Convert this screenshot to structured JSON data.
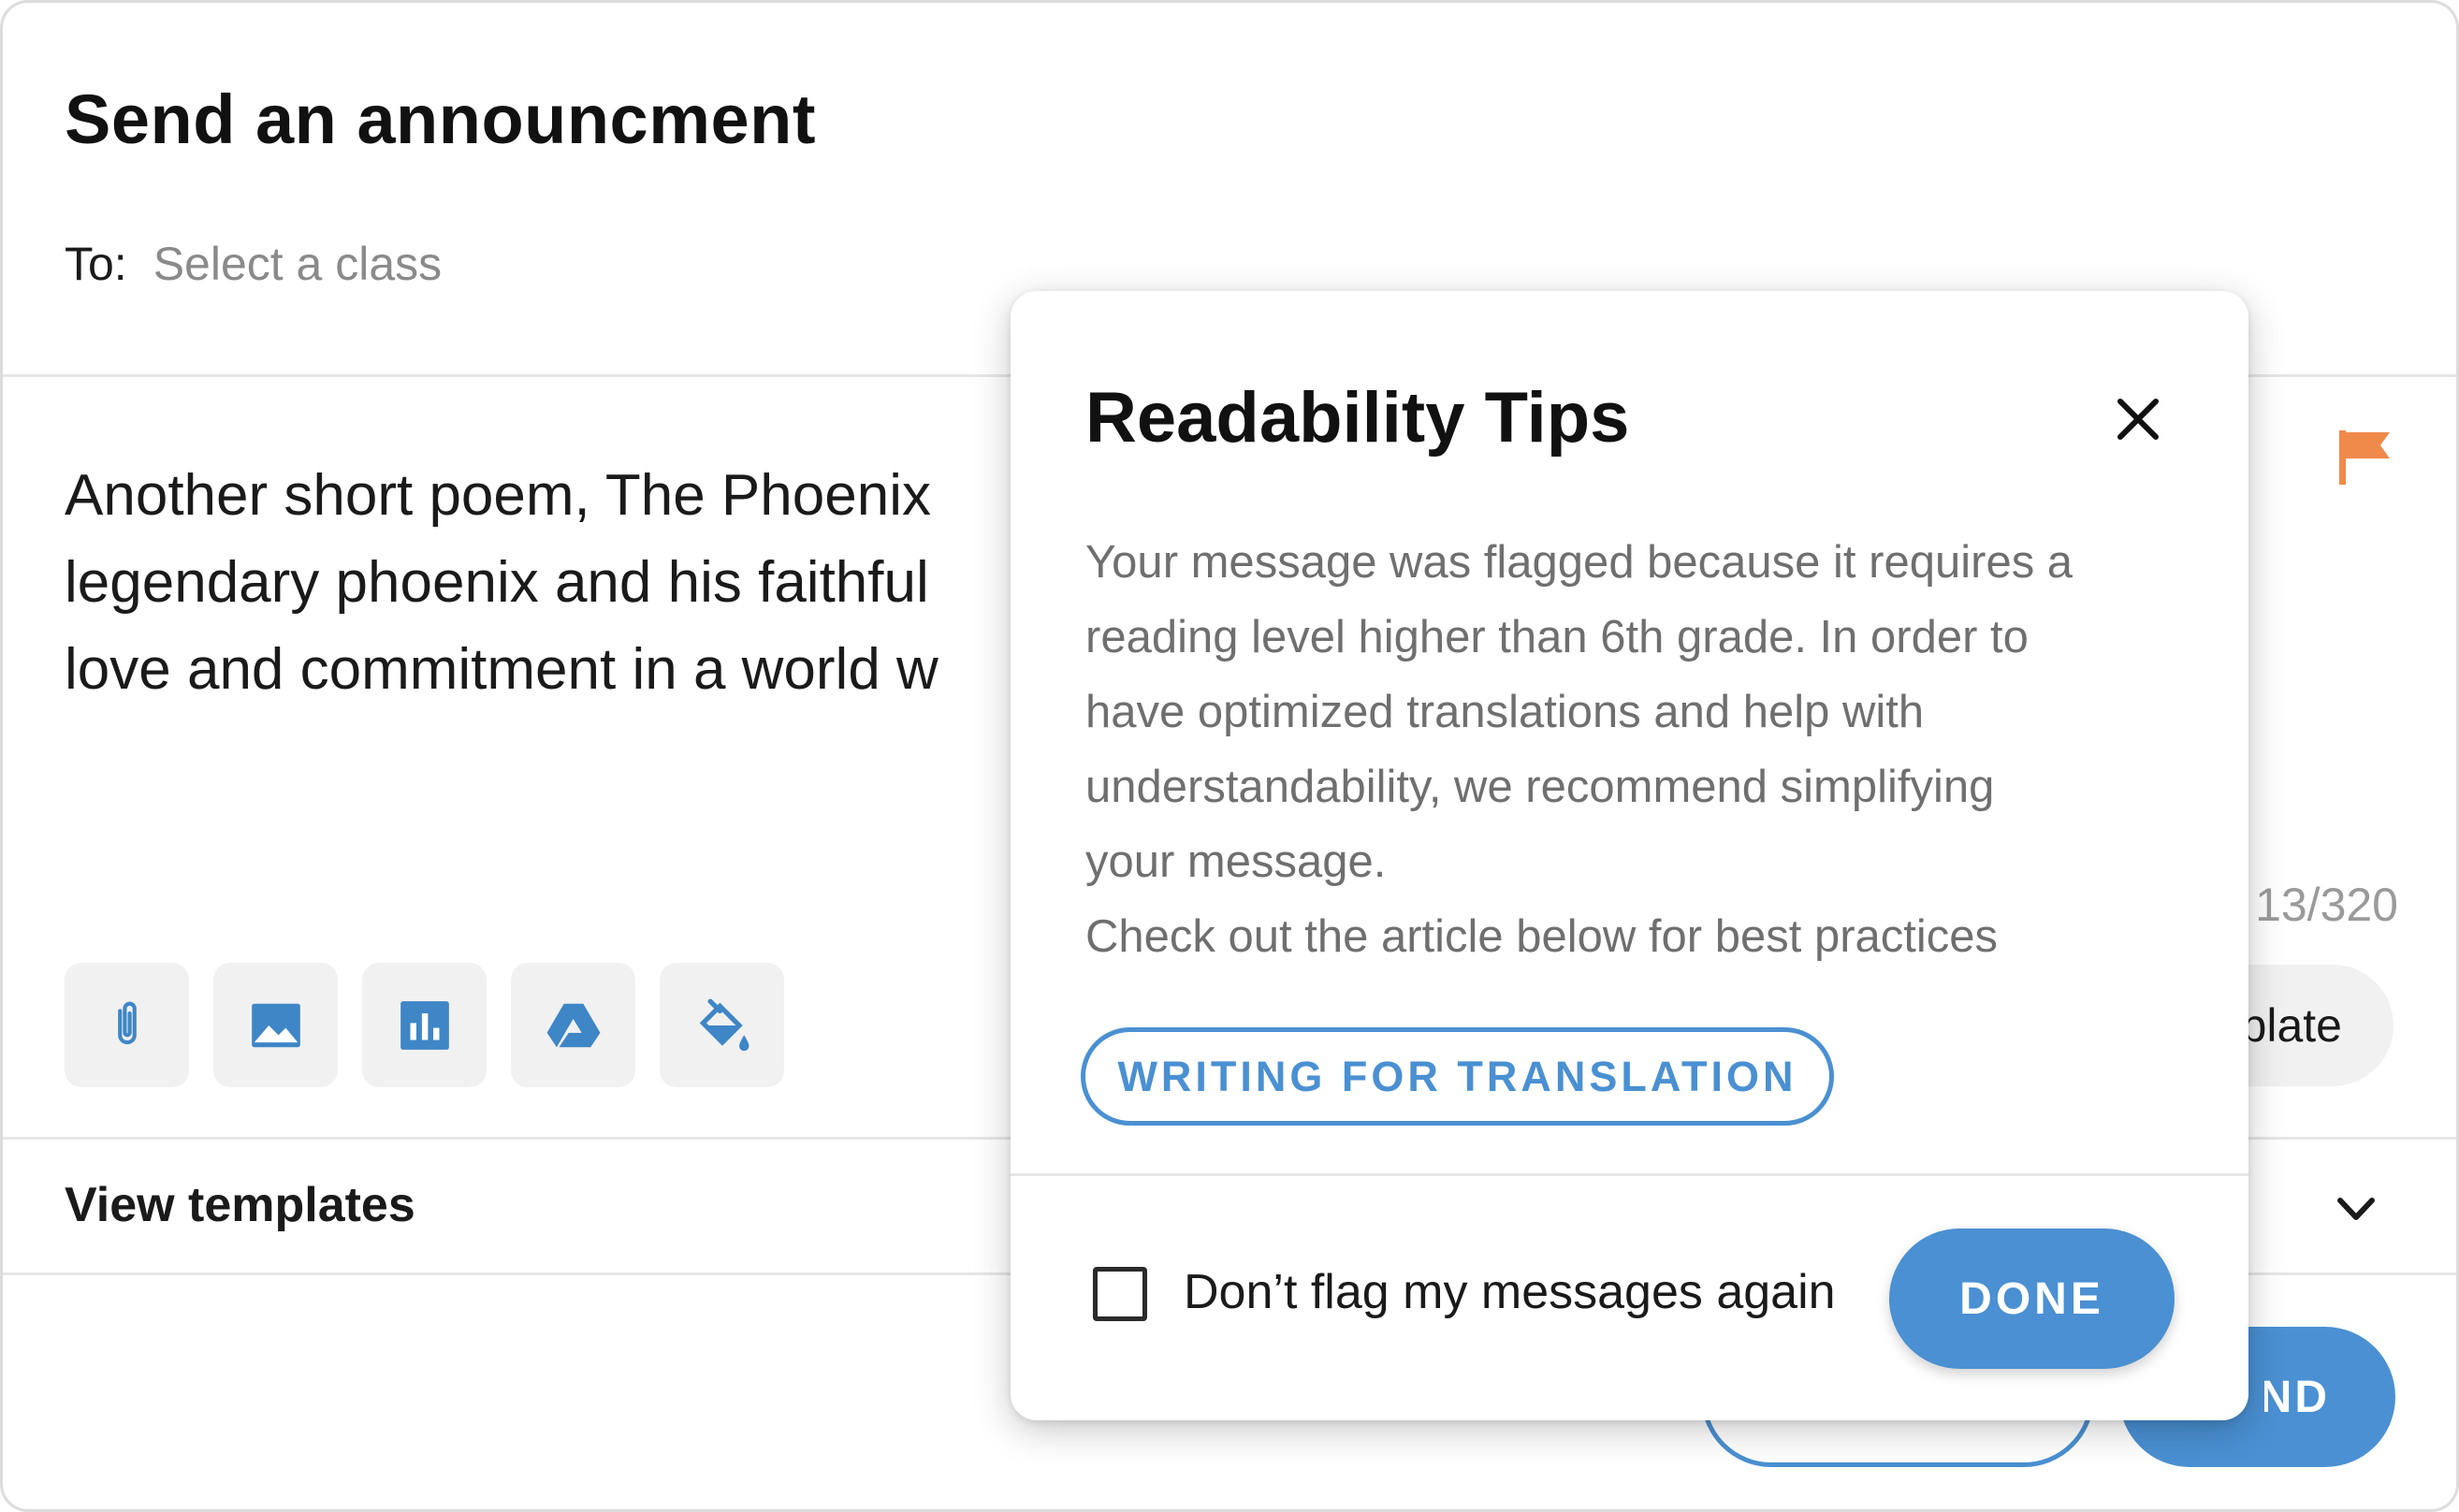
{
  "header": {
    "title": "Send an announcment",
    "to_label": "To:",
    "to_placeholder": "Select a class"
  },
  "message": {
    "lines": [
      "Another short poem, The Phoenix",
      "legendary phoenix and his faithful",
      "love and commitment in a world w"
    ],
    "char_count": "13/320"
  },
  "toolbar": {
    "items": [
      {
        "icon": "paperclip-icon"
      },
      {
        "icon": "image-icon"
      },
      {
        "icon": "chart-icon"
      },
      {
        "icon": "drive-icon"
      },
      {
        "icon": "paint-bucket-icon"
      }
    ],
    "template_button_label": "plate"
  },
  "templates": {
    "label": "View templates"
  },
  "footer": {
    "send_label": "ND"
  },
  "modal": {
    "title": "Readability Tips",
    "paragraph_lines": [
      "Your message was flagged because it requires a",
      "reading level higher than 6th grade. In order to",
      "have optimized translations and help with",
      "understandability, we recommend simplifying",
      "your message.",
      "Check out the article below for best practices"
    ],
    "article_button": "WRITING FOR TRANSLATION",
    "checkbox_label": "Don’t flag my messages again",
    "checkbox_checked": false,
    "done_button": "DONE"
  },
  "colors": {
    "accent": "#4a90d2",
    "flag": "#f08a4b",
    "icon": "#3f86c6"
  }
}
